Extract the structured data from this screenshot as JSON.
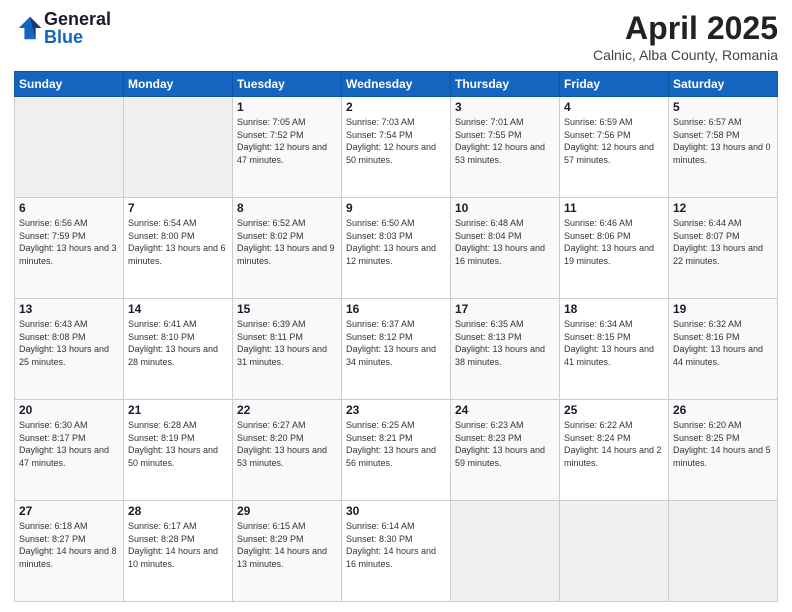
{
  "header": {
    "logo_general": "General",
    "logo_blue": "Blue",
    "month_title": "April 2025",
    "location": "Calnic, Alba County, Romania"
  },
  "days_of_week": [
    "Sunday",
    "Monday",
    "Tuesday",
    "Wednesday",
    "Thursday",
    "Friday",
    "Saturday"
  ],
  "weeks": [
    [
      {
        "day": "",
        "info": ""
      },
      {
        "day": "",
        "info": ""
      },
      {
        "day": "1",
        "info": "Sunrise: 7:05 AM\nSunset: 7:52 PM\nDaylight: 12 hours and 47 minutes."
      },
      {
        "day": "2",
        "info": "Sunrise: 7:03 AM\nSunset: 7:54 PM\nDaylight: 12 hours and 50 minutes."
      },
      {
        "day": "3",
        "info": "Sunrise: 7:01 AM\nSunset: 7:55 PM\nDaylight: 12 hours and 53 minutes."
      },
      {
        "day": "4",
        "info": "Sunrise: 6:59 AM\nSunset: 7:56 PM\nDaylight: 12 hours and 57 minutes."
      },
      {
        "day": "5",
        "info": "Sunrise: 6:57 AM\nSunset: 7:58 PM\nDaylight: 13 hours and 0 minutes."
      }
    ],
    [
      {
        "day": "6",
        "info": "Sunrise: 6:56 AM\nSunset: 7:59 PM\nDaylight: 13 hours and 3 minutes."
      },
      {
        "day": "7",
        "info": "Sunrise: 6:54 AM\nSunset: 8:00 PM\nDaylight: 13 hours and 6 minutes."
      },
      {
        "day": "8",
        "info": "Sunrise: 6:52 AM\nSunset: 8:02 PM\nDaylight: 13 hours and 9 minutes."
      },
      {
        "day": "9",
        "info": "Sunrise: 6:50 AM\nSunset: 8:03 PM\nDaylight: 13 hours and 12 minutes."
      },
      {
        "day": "10",
        "info": "Sunrise: 6:48 AM\nSunset: 8:04 PM\nDaylight: 13 hours and 16 minutes."
      },
      {
        "day": "11",
        "info": "Sunrise: 6:46 AM\nSunset: 8:06 PM\nDaylight: 13 hours and 19 minutes."
      },
      {
        "day": "12",
        "info": "Sunrise: 6:44 AM\nSunset: 8:07 PM\nDaylight: 13 hours and 22 minutes."
      }
    ],
    [
      {
        "day": "13",
        "info": "Sunrise: 6:43 AM\nSunset: 8:08 PM\nDaylight: 13 hours and 25 minutes."
      },
      {
        "day": "14",
        "info": "Sunrise: 6:41 AM\nSunset: 8:10 PM\nDaylight: 13 hours and 28 minutes."
      },
      {
        "day": "15",
        "info": "Sunrise: 6:39 AM\nSunset: 8:11 PM\nDaylight: 13 hours and 31 minutes."
      },
      {
        "day": "16",
        "info": "Sunrise: 6:37 AM\nSunset: 8:12 PM\nDaylight: 13 hours and 34 minutes."
      },
      {
        "day": "17",
        "info": "Sunrise: 6:35 AM\nSunset: 8:13 PM\nDaylight: 13 hours and 38 minutes."
      },
      {
        "day": "18",
        "info": "Sunrise: 6:34 AM\nSunset: 8:15 PM\nDaylight: 13 hours and 41 minutes."
      },
      {
        "day": "19",
        "info": "Sunrise: 6:32 AM\nSunset: 8:16 PM\nDaylight: 13 hours and 44 minutes."
      }
    ],
    [
      {
        "day": "20",
        "info": "Sunrise: 6:30 AM\nSunset: 8:17 PM\nDaylight: 13 hours and 47 minutes."
      },
      {
        "day": "21",
        "info": "Sunrise: 6:28 AM\nSunset: 8:19 PM\nDaylight: 13 hours and 50 minutes."
      },
      {
        "day": "22",
        "info": "Sunrise: 6:27 AM\nSunset: 8:20 PM\nDaylight: 13 hours and 53 minutes."
      },
      {
        "day": "23",
        "info": "Sunrise: 6:25 AM\nSunset: 8:21 PM\nDaylight: 13 hours and 56 minutes."
      },
      {
        "day": "24",
        "info": "Sunrise: 6:23 AM\nSunset: 8:23 PM\nDaylight: 13 hours and 59 minutes."
      },
      {
        "day": "25",
        "info": "Sunrise: 6:22 AM\nSunset: 8:24 PM\nDaylight: 14 hours and 2 minutes."
      },
      {
        "day": "26",
        "info": "Sunrise: 6:20 AM\nSunset: 8:25 PM\nDaylight: 14 hours and 5 minutes."
      }
    ],
    [
      {
        "day": "27",
        "info": "Sunrise: 6:18 AM\nSunset: 8:27 PM\nDaylight: 14 hours and 8 minutes."
      },
      {
        "day": "28",
        "info": "Sunrise: 6:17 AM\nSunset: 8:28 PM\nDaylight: 14 hours and 10 minutes."
      },
      {
        "day": "29",
        "info": "Sunrise: 6:15 AM\nSunset: 8:29 PM\nDaylight: 14 hours and 13 minutes."
      },
      {
        "day": "30",
        "info": "Sunrise: 6:14 AM\nSunset: 8:30 PM\nDaylight: 14 hours and 16 minutes."
      },
      {
        "day": "",
        "info": ""
      },
      {
        "day": "",
        "info": ""
      },
      {
        "day": "",
        "info": ""
      }
    ]
  ]
}
